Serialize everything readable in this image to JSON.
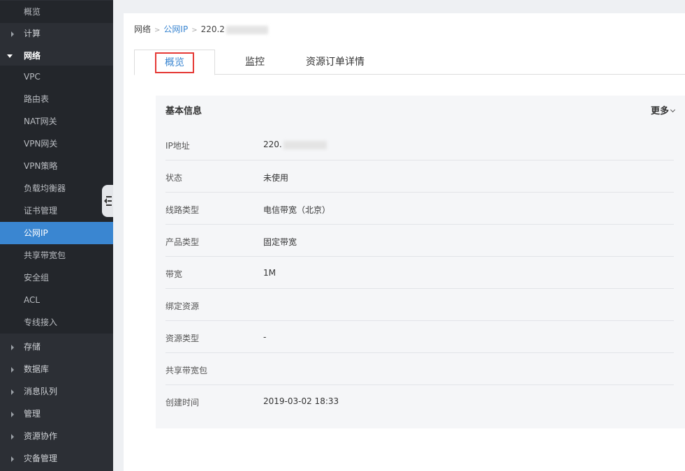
{
  "sidebar": {
    "items": [
      {
        "label": "概览",
        "kind": "child"
      },
      {
        "label": "计算",
        "kind": "parent"
      },
      {
        "label": "网络",
        "kind": "parent-open"
      },
      {
        "label": "VPC",
        "kind": "child"
      },
      {
        "label": "路由表",
        "kind": "child"
      },
      {
        "label": "NAT网关",
        "kind": "child"
      },
      {
        "label": "VPN网关",
        "kind": "child"
      },
      {
        "label": "VPN策略",
        "kind": "child"
      },
      {
        "label": "负载均衡器",
        "kind": "child"
      },
      {
        "label": "证书管理",
        "kind": "child"
      },
      {
        "label": "公网IP",
        "kind": "child-active"
      },
      {
        "label": "共享带宽包",
        "kind": "child"
      },
      {
        "label": "安全组",
        "kind": "child"
      },
      {
        "label": "ACL",
        "kind": "child"
      },
      {
        "label": "专线接入",
        "kind": "child"
      },
      {
        "label": "存储",
        "kind": "parent"
      },
      {
        "label": "数据库",
        "kind": "parent"
      },
      {
        "label": "消息队列",
        "kind": "parent"
      },
      {
        "label": "管理",
        "kind": "parent"
      },
      {
        "label": "资源协作",
        "kind": "parent"
      },
      {
        "label": "灾备管理",
        "kind": "parent"
      }
    ],
    "active_color": "#3a86d1",
    "bg_color": "#2c2f35"
  },
  "breadcrumb": {
    "root": "网络",
    "section": "公网IP",
    "current": "220.2"
  },
  "tabs": [
    {
      "label": "概览",
      "active": true
    },
    {
      "label": "监控",
      "active": false
    },
    {
      "label": "资源订单详情",
      "active": false
    }
  ],
  "info": {
    "title": "基本信息",
    "more_label": "更多",
    "rows": [
      {
        "label": "IP地址",
        "value": "220."
      },
      {
        "label": "状态",
        "value": "未使用"
      },
      {
        "label": "线路类型",
        "value": "电信带宽（北京）"
      },
      {
        "label": "产品类型",
        "value": "固定带宽"
      },
      {
        "label": "带宽",
        "value": "1M"
      },
      {
        "label": "绑定资源",
        "value": ""
      },
      {
        "label": "资源类型",
        "value": "-"
      },
      {
        "label": "共享带宽包",
        "value": ""
      },
      {
        "label": "创建时间",
        "value": "2019-03-02 18:33"
      }
    ]
  },
  "colors": {
    "highlight_box": "#e53935",
    "link": "#3a86d1"
  }
}
